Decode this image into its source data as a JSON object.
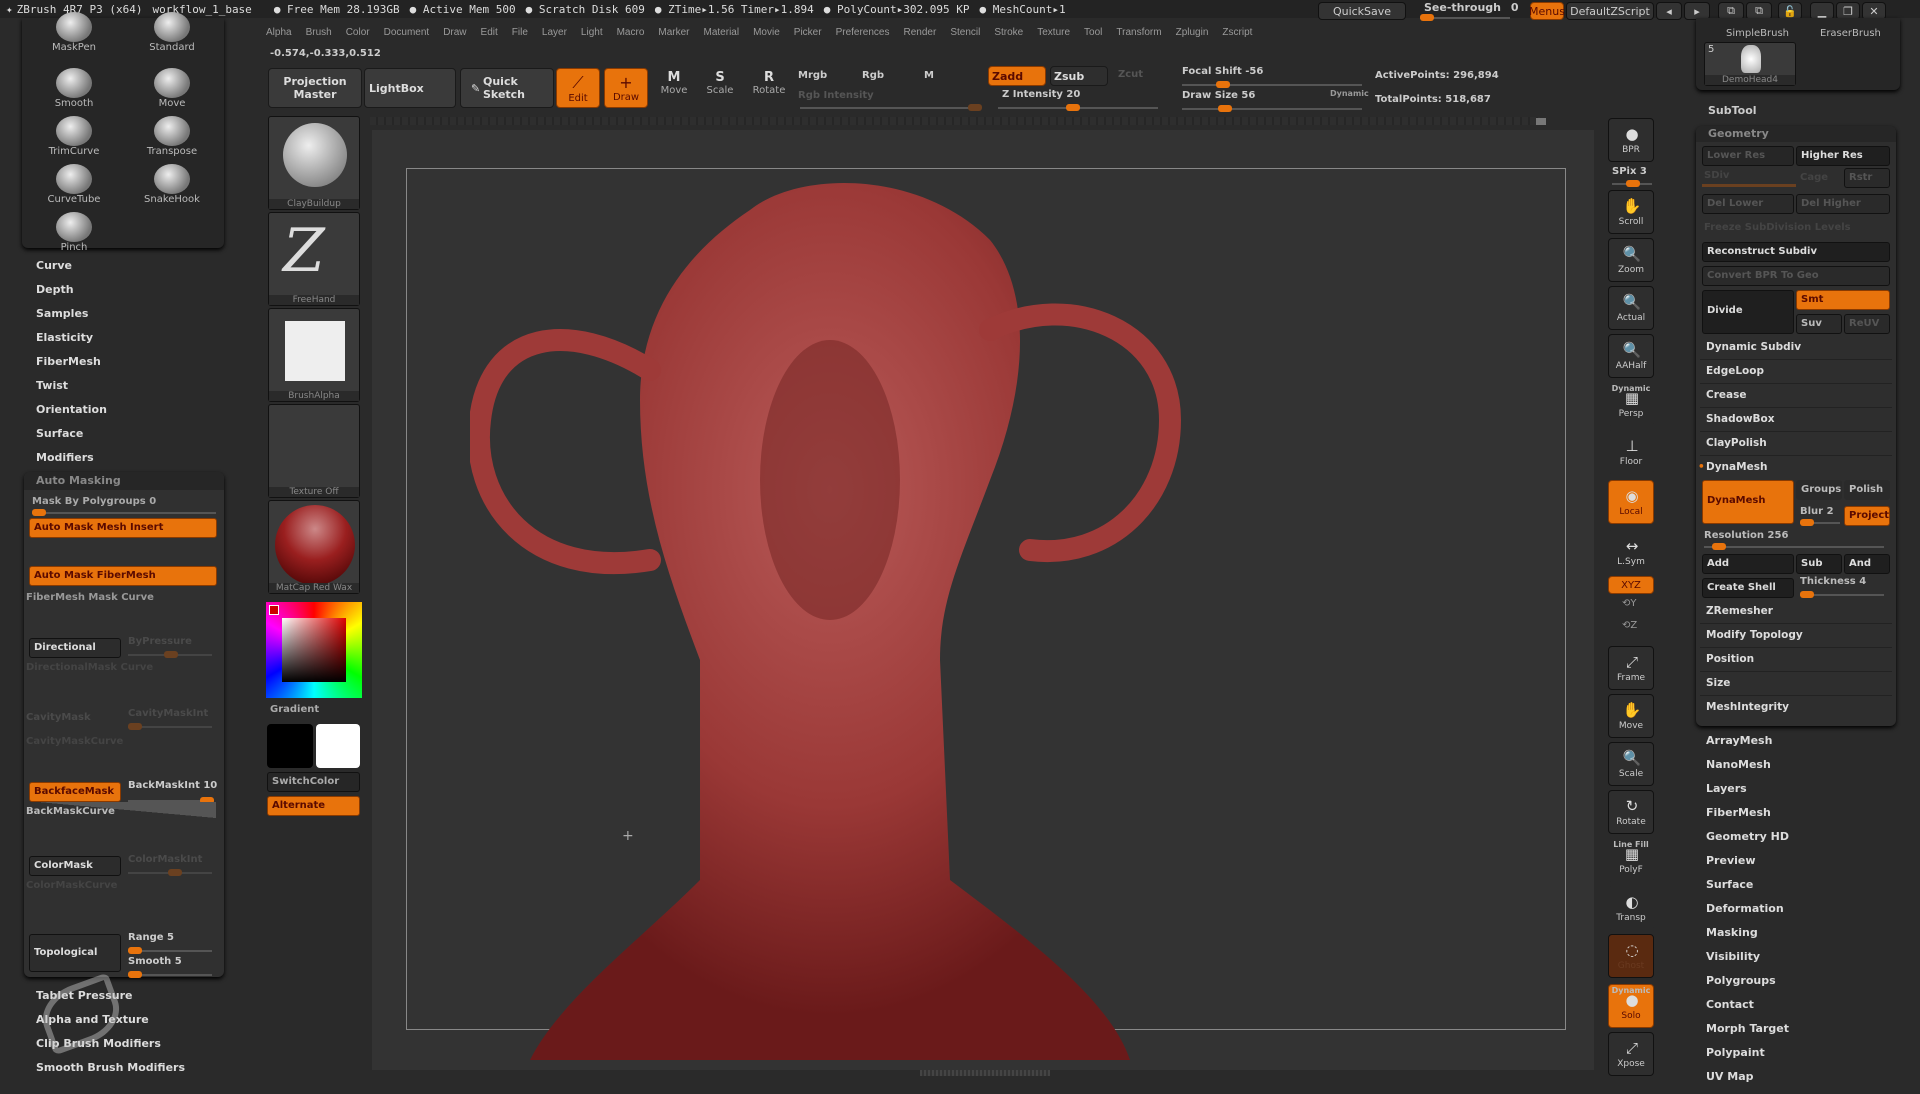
{
  "titlebar": {
    "app": "ZBrush 4R7 P3 (x64)",
    "document": "workflow_1_base",
    "free_mem": "● Free Mem 28.193GB",
    "active_mem": "● Active Mem 500",
    "scratch": "● Scratch Disk 609",
    "ztime": "● ZTime▸1.56 Timer▸1.894",
    "polycount": "● PolyCount▸302.095 KP",
    "meshcount": "● MeshCount▸1"
  },
  "top_right": {
    "quicksave": "QuickSave",
    "see_through_label": "See-through",
    "see_through_value": "0",
    "menus": "Menus",
    "default_zscript": "DefaultZScript"
  },
  "menubar": [
    "Alpha",
    "Brush",
    "Color",
    "Document",
    "Draw",
    "Edit",
    "File",
    "Layer",
    "Light",
    "Macro",
    "Marker",
    "Material",
    "Movie",
    "Picker",
    "Preferences",
    "Render",
    "Stencil",
    "Stroke",
    "Texture",
    "Tool",
    "Transform",
    "Zplugin",
    "Zscript"
  ],
  "coords": "-0.574,-0.333,0.512",
  "toolbar": {
    "projection_master": "Projection Master",
    "lightbox": "LightBox",
    "quick_sketch": "Quick Sketch",
    "edit": "Edit",
    "draw": "Draw",
    "move": "Move",
    "scale": "Scale",
    "rotate": "Rotate",
    "mrgb": "Mrgb",
    "rgb": "Rgb",
    "m": "M",
    "rgb_intensity": "Rgb Intensity",
    "zadd": "Zadd",
    "zsub": "Zsub",
    "zcut": "Zcut",
    "z_intensity": "Z Intensity 20",
    "focal_shift": "Focal Shift -56",
    "draw_size": "Draw Size 56",
    "dynamic": "Dynamic",
    "active_points": "ActivePoints: 296,894",
    "total_points": "TotalPoints: 518,687"
  },
  "brush_tray": [
    {
      "label": "MaskPen"
    },
    {
      "label": "Standard"
    },
    {
      "label": "Smooth"
    },
    {
      "label": "Move"
    },
    {
      "label": "TrimCurve"
    },
    {
      "label": "Transpose"
    },
    {
      "label": "CurveTube"
    },
    {
      "label": "SnakeHook"
    },
    {
      "label": "Pinch"
    }
  ],
  "left_list": [
    "Curve",
    "Depth",
    "Samples",
    "Elasticity",
    "FiberMesh",
    "Twist",
    "Orientation",
    "Surface",
    "Modifiers"
  ],
  "auto_masking": {
    "title": "Auto Masking",
    "mask_by_polygroups": "Mask By Polygroups 0",
    "auto_mask_mesh_insert": "Auto Mask Mesh Insert",
    "auto_mask_fibermesh": "Auto Mask FiberMesh",
    "fibermesh_mask_curve": "FiberMesh Mask Curve",
    "directional": "Directional",
    "bypressure": "ByPressure",
    "directional_mask_curve": "DirectionalMask Curve",
    "cavity_mask": "CavityMask",
    "cavity_mask_int": "CavityMaskInt",
    "cavity_mask_curve": "CavityMaskCurve",
    "backface_mask": "BackfaceMask",
    "backmask_int": "BackMaskInt 10",
    "backmask_curve": "BackMaskCurve",
    "color_mask": "ColorMask",
    "color_mask_int": "ColorMaskInt",
    "color_mask_curve": "ColorMaskCurve",
    "topological": "Topological",
    "range": "Range 5",
    "smooth": "Smooth 5"
  },
  "left_list_bottom": [
    "Tablet Pressure",
    "Alpha and Texture",
    "Clip Brush Modifiers",
    "Smooth Brush Modifiers"
  ],
  "swatches": {
    "brush": "ClayBuildup",
    "stroke": "FreeHand",
    "alpha": "BrushAlpha",
    "texture": "Texture Off",
    "material": "MatCap Red Wax",
    "gradient": "Gradient",
    "switch_color": "SwitchColor",
    "alternate": "Alternate"
  },
  "right_shelf": {
    "bpr": "BPR",
    "spix": "SPix 3",
    "scroll": "Scroll",
    "zoom": "Zoom",
    "actual": "Actual",
    "aahalf": "AAHalf",
    "persp_top": "Dynamic",
    "persp": "Persp",
    "floor": "Floor",
    "local": "Local",
    "lsym": "L.Sym",
    "xyz": "XYZ",
    "frame": "Frame",
    "move": "Move",
    "scale": "Scale",
    "rotate": "Rotate",
    "polyf_top": "Line Fill",
    "polyf": "PolyF",
    "transp": "Transp",
    "ghost": "Ghost",
    "solo_top": "Dynamic",
    "solo": "Solo",
    "xpose": "Xpose"
  },
  "tool_tray": {
    "simple_brush": "SimpleBrush",
    "eraser_brush": "EraserBrush",
    "demohead_count": "5",
    "demohead": "DemoHead4"
  },
  "subtool": "SubTool",
  "geometry": {
    "title": "Geometry",
    "lower_res": "Lower Res",
    "higher_res": "Higher Res",
    "sdiv": "SDiv",
    "cage": "Cage",
    "rstr": "Rstr",
    "del_lower": "Del Lower",
    "del_higher": "Del Higher",
    "freeze": "Freeze SubDivision Levels",
    "reconstruct": "Reconstruct Subdiv",
    "convert_bpr": "Convert BPR To Geo",
    "divide": "Divide",
    "smt": "Smt",
    "suv": "Suv",
    "reuv": "ReUV",
    "rows": [
      "Dynamic Subdiv",
      "EdgeLoop",
      "Crease",
      "ShadowBox",
      "ClayPolish"
    ],
    "dynamesh_header": "DynaMesh",
    "dynamesh_btn": "DynaMesh",
    "groups": "Groups",
    "polish": "Polish",
    "blur": "Blur 2",
    "project": "Project",
    "resolution": "Resolution 256",
    "add": "Add",
    "sub": "Sub",
    "and": "And",
    "create_shell": "Create Shell",
    "thickness": "Thickness 4",
    "rows2": [
      "ZRemesher",
      "Modify Topology",
      "Position",
      "Size",
      "MeshIntegrity"
    ]
  },
  "right_list": [
    "ArrayMesh",
    "NanoMesh",
    "Layers",
    "FiberMesh",
    "Geometry HD",
    "Preview",
    "Surface",
    "Deformation",
    "Masking",
    "Visibility",
    "Polygroups",
    "Contact",
    "Morph Target",
    "Polypaint",
    "UV Map"
  ],
  "colors": {
    "accent": "#e8730c",
    "background": "#2a2a2a",
    "model": "#9e3a38"
  }
}
